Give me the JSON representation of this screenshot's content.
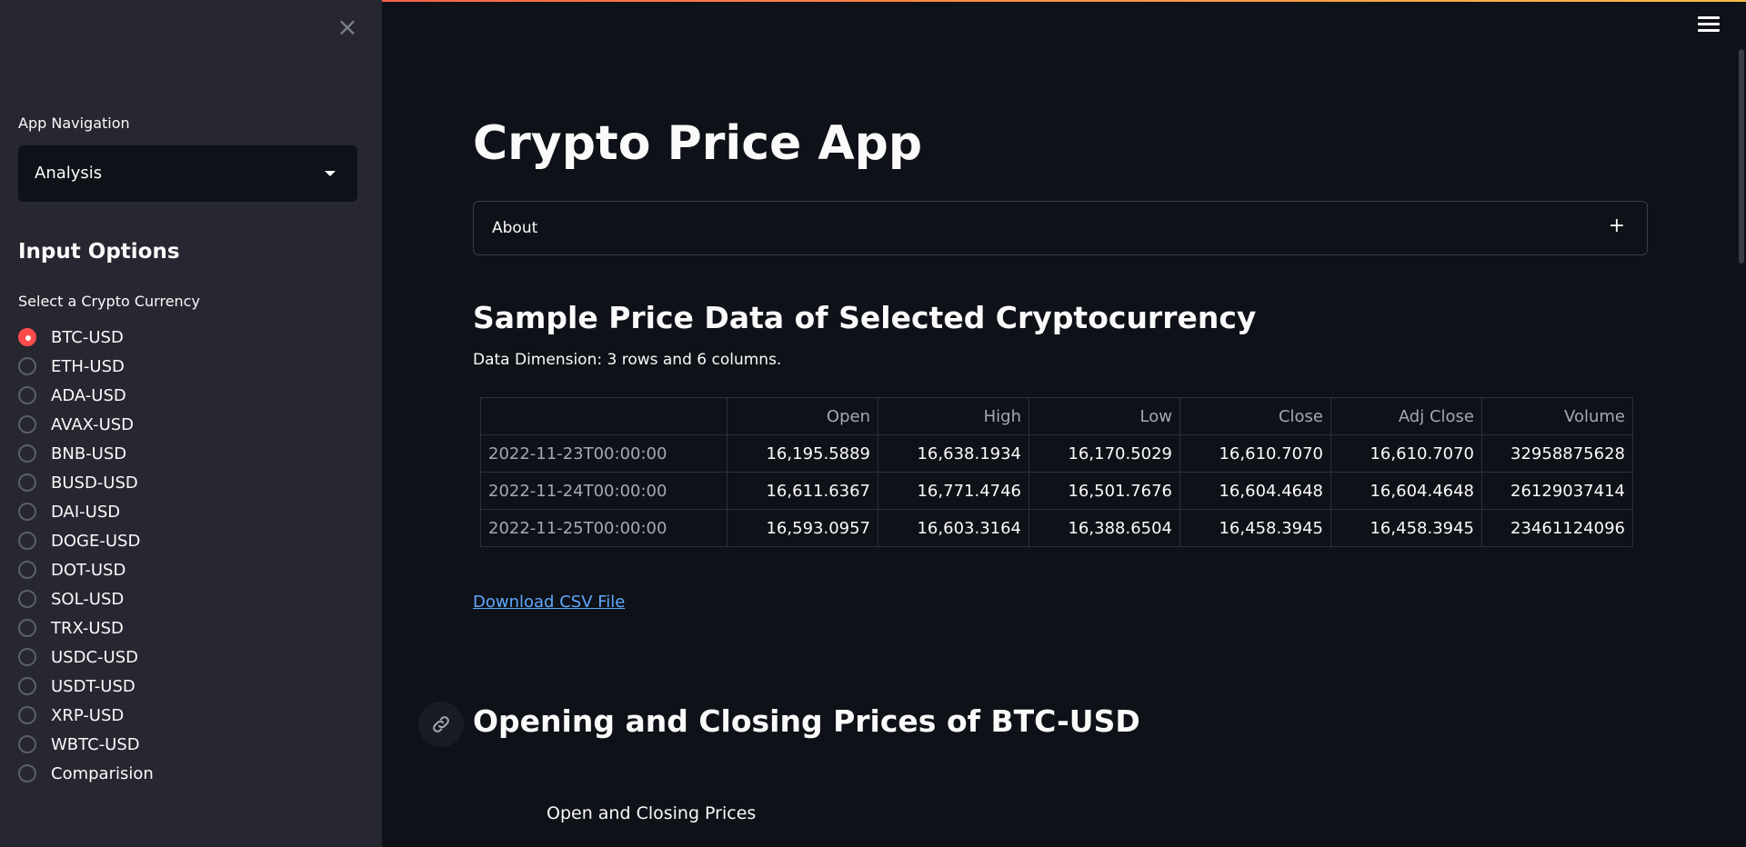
{
  "sidebar": {
    "nav_label": "App Navigation",
    "nav_selected": "Analysis",
    "input_heading": "Input Options",
    "radio_label": "Select a Crypto Currency",
    "options": [
      "BTC-USD",
      "ETH-USD",
      "ADA-USD",
      "AVAX-USD",
      "BNB-USD",
      "BUSD-USD",
      "DAI-USD",
      "DOGE-USD",
      "DOT-USD",
      "SOL-USD",
      "TRX-USD",
      "USDC-USD",
      "USDT-USD",
      "XRP-USD",
      "WBTC-USD",
      "Comparision"
    ],
    "selected_option": "BTC-USD"
  },
  "main": {
    "title": "Crypto Price App",
    "expander_label": "About",
    "section1_title": "Sample Price Data of Selected Cryptocurrency",
    "dimension_text": "Data Dimension: 3 rows and 6 columns.",
    "table": {
      "columns": [
        "",
        "Open",
        "High",
        "Low",
        "Close",
        "Adj Close",
        "Volume"
      ],
      "rows": [
        [
          "2022-11-23T00:00:00",
          "16,195.5889",
          "16,638.1934",
          "16,170.5029",
          "16,610.7070",
          "16,610.7070",
          "32958875628"
        ],
        [
          "2022-11-24T00:00:00",
          "16,611.6367",
          "16,771.4746",
          "16,501.7676",
          "16,604.4648",
          "16,604.4648",
          "26129037414"
        ],
        [
          "2022-11-25T00:00:00",
          "16,593.0957",
          "16,603.3164",
          "16,388.6504",
          "16,458.3945",
          "16,458.3945",
          "23461124096"
        ]
      ]
    },
    "download_link": "Download CSV File",
    "section2_title": "Opening and Closing Prices of BTC-USD",
    "chart_title": "Open and Closing Prices"
  },
  "colors": {
    "accent": "#ff4b4b",
    "link": "#5fa8ff",
    "background": "#0e1117",
    "sidebar": "#262730"
  }
}
